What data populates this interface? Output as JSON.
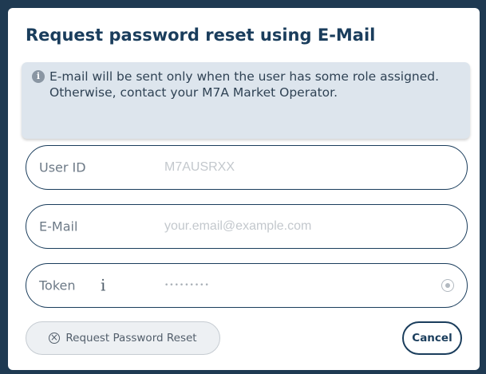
{
  "dialog": {
    "title": "Request password reset using E-Mail",
    "info_text": "E-mail will be sent only when the user has some role assigned. Otherwise, contact your M7A Market Operator."
  },
  "fields": {
    "user_id": {
      "label": "User ID",
      "placeholder": "M7AUSRXX"
    },
    "email": {
      "label": "E-Mail",
      "placeholder": "your.email@example.com"
    },
    "token": {
      "label": "Token",
      "info_glyph": "i",
      "masked_value": "•••••••••"
    }
  },
  "buttons": {
    "request_label": "Request Password Reset",
    "cancel_label": "Cancel"
  },
  "colors": {
    "primary": "#1a3d5c",
    "info_background": "#dde5ed",
    "disabled_button": "#edf0f3"
  },
  "icons": {
    "info": "info-circle-icon",
    "eye": "eye-icon",
    "reset": "reset-circle-icon"
  }
}
